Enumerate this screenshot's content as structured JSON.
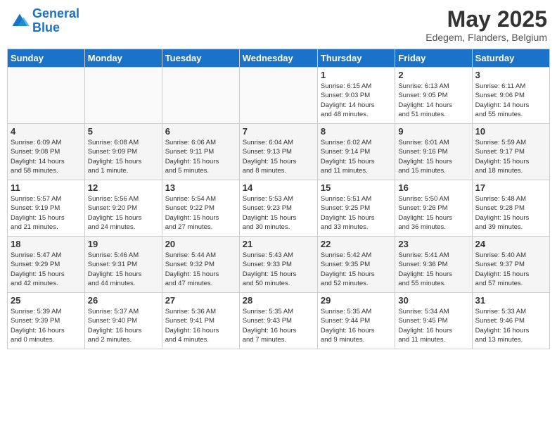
{
  "header": {
    "logo_line1": "General",
    "logo_line2": "Blue",
    "month": "May 2025",
    "location": "Edegem, Flanders, Belgium"
  },
  "weekdays": [
    "Sunday",
    "Monday",
    "Tuesday",
    "Wednesday",
    "Thursday",
    "Friday",
    "Saturday"
  ],
  "weeks": [
    [
      {
        "day": "",
        "info": ""
      },
      {
        "day": "",
        "info": ""
      },
      {
        "day": "",
        "info": ""
      },
      {
        "day": "",
        "info": ""
      },
      {
        "day": "1",
        "info": "Sunrise: 6:15 AM\nSunset: 9:03 PM\nDaylight: 14 hours\nand 48 minutes."
      },
      {
        "day": "2",
        "info": "Sunrise: 6:13 AM\nSunset: 9:05 PM\nDaylight: 14 hours\nand 51 minutes."
      },
      {
        "day": "3",
        "info": "Sunrise: 6:11 AM\nSunset: 9:06 PM\nDaylight: 14 hours\nand 55 minutes."
      }
    ],
    [
      {
        "day": "4",
        "info": "Sunrise: 6:09 AM\nSunset: 9:08 PM\nDaylight: 14 hours\nand 58 minutes."
      },
      {
        "day": "5",
        "info": "Sunrise: 6:08 AM\nSunset: 9:09 PM\nDaylight: 15 hours\nand 1 minute."
      },
      {
        "day": "6",
        "info": "Sunrise: 6:06 AM\nSunset: 9:11 PM\nDaylight: 15 hours\nand 5 minutes."
      },
      {
        "day": "7",
        "info": "Sunrise: 6:04 AM\nSunset: 9:13 PM\nDaylight: 15 hours\nand 8 minutes."
      },
      {
        "day": "8",
        "info": "Sunrise: 6:02 AM\nSunset: 9:14 PM\nDaylight: 15 hours\nand 11 minutes."
      },
      {
        "day": "9",
        "info": "Sunrise: 6:01 AM\nSunset: 9:16 PM\nDaylight: 15 hours\nand 15 minutes."
      },
      {
        "day": "10",
        "info": "Sunrise: 5:59 AM\nSunset: 9:17 PM\nDaylight: 15 hours\nand 18 minutes."
      }
    ],
    [
      {
        "day": "11",
        "info": "Sunrise: 5:57 AM\nSunset: 9:19 PM\nDaylight: 15 hours\nand 21 minutes."
      },
      {
        "day": "12",
        "info": "Sunrise: 5:56 AM\nSunset: 9:20 PM\nDaylight: 15 hours\nand 24 minutes."
      },
      {
        "day": "13",
        "info": "Sunrise: 5:54 AM\nSunset: 9:22 PM\nDaylight: 15 hours\nand 27 minutes."
      },
      {
        "day": "14",
        "info": "Sunrise: 5:53 AM\nSunset: 9:23 PM\nDaylight: 15 hours\nand 30 minutes."
      },
      {
        "day": "15",
        "info": "Sunrise: 5:51 AM\nSunset: 9:25 PM\nDaylight: 15 hours\nand 33 minutes."
      },
      {
        "day": "16",
        "info": "Sunrise: 5:50 AM\nSunset: 9:26 PM\nDaylight: 15 hours\nand 36 minutes."
      },
      {
        "day": "17",
        "info": "Sunrise: 5:48 AM\nSunset: 9:28 PM\nDaylight: 15 hours\nand 39 minutes."
      }
    ],
    [
      {
        "day": "18",
        "info": "Sunrise: 5:47 AM\nSunset: 9:29 PM\nDaylight: 15 hours\nand 42 minutes."
      },
      {
        "day": "19",
        "info": "Sunrise: 5:46 AM\nSunset: 9:31 PM\nDaylight: 15 hours\nand 44 minutes."
      },
      {
        "day": "20",
        "info": "Sunrise: 5:44 AM\nSunset: 9:32 PM\nDaylight: 15 hours\nand 47 minutes."
      },
      {
        "day": "21",
        "info": "Sunrise: 5:43 AM\nSunset: 9:33 PM\nDaylight: 15 hours\nand 50 minutes."
      },
      {
        "day": "22",
        "info": "Sunrise: 5:42 AM\nSunset: 9:35 PM\nDaylight: 15 hours\nand 52 minutes."
      },
      {
        "day": "23",
        "info": "Sunrise: 5:41 AM\nSunset: 9:36 PM\nDaylight: 15 hours\nand 55 minutes."
      },
      {
        "day": "24",
        "info": "Sunrise: 5:40 AM\nSunset: 9:37 PM\nDaylight: 15 hours\nand 57 minutes."
      }
    ],
    [
      {
        "day": "25",
        "info": "Sunrise: 5:39 AM\nSunset: 9:39 PM\nDaylight: 16 hours\nand 0 minutes."
      },
      {
        "day": "26",
        "info": "Sunrise: 5:37 AM\nSunset: 9:40 PM\nDaylight: 16 hours\nand 2 minutes."
      },
      {
        "day": "27",
        "info": "Sunrise: 5:36 AM\nSunset: 9:41 PM\nDaylight: 16 hours\nand 4 minutes."
      },
      {
        "day": "28",
        "info": "Sunrise: 5:35 AM\nSunset: 9:43 PM\nDaylight: 16 hours\nand 7 minutes."
      },
      {
        "day": "29",
        "info": "Sunrise: 5:35 AM\nSunset: 9:44 PM\nDaylight: 16 hours\nand 9 minutes."
      },
      {
        "day": "30",
        "info": "Sunrise: 5:34 AM\nSunset: 9:45 PM\nDaylight: 16 hours\nand 11 minutes."
      },
      {
        "day": "31",
        "info": "Sunrise: 5:33 AM\nSunset: 9:46 PM\nDaylight: 16 hours\nand 13 minutes."
      }
    ]
  ]
}
